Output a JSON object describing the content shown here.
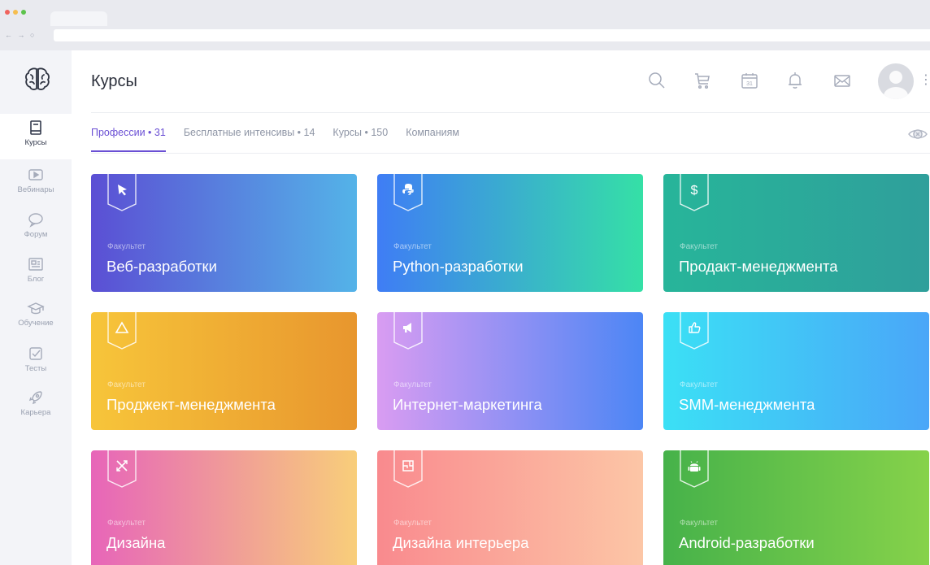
{
  "header": {
    "title": "Курсы"
  },
  "sidebar": {
    "items": [
      {
        "label": "Курсы",
        "icon": "book-icon"
      },
      {
        "label": "Вебинары",
        "icon": "play-icon"
      },
      {
        "label": "Форум",
        "icon": "chat-icon"
      },
      {
        "label": "Блог",
        "icon": "newspaper-icon"
      },
      {
        "label": "Обучение",
        "icon": "graduation-cap-icon"
      },
      {
        "label": "Тесты",
        "icon": "checkbox-icon"
      },
      {
        "label": "Карьера",
        "icon": "rocket-icon"
      }
    ]
  },
  "tabs": [
    {
      "label": "Профессии • 31",
      "active": true
    },
    {
      "label": "Бесплатные интенсивы • 14",
      "active": false
    },
    {
      "label": "Курсы • 150",
      "active": false
    },
    {
      "label": "Компаниям",
      "active": false
    }
  ],
  "cards": [
    {
      "kicker": "Факультет",
      "title": "Веб-разработки",
      "icon": "cursor-icon",
      "colors": [
        "#5b4fd4",
        "#54b3e8"
      ]
    },
    {
      "kicker": "Факультет",
      "title": "Python-разработки",
      "icon": "python-icon",
      "colors": [
        "#3f7df5",
        "#35e0a6"
      ]
    },
    {
      "kicker": "Факультет",
      "title": "Продакт-менеджмента",
      "icon": "dollar-icon",
      "colors": [
        "#27b59a",
        "#2f9f9b"
      ]
    },
    {
      "kicker": "Факультет",
      "title": "Проджект-менеджмента",
      "icon": "triangle-icon",
      "colors": [
        "#f7c53a",
        "#e8962e"
      ]
    },
    {
      "kicker": "Факультет",
      "title": "Интернет-маркетинга",
      "icon": "megaphone-icon",
      "colors": [
        "#d99cf2",
        "#4c86f5"
      ]
    },
    {
      "kicker": "Факультет",
      "title": "SMM-менеджмента",
      "icon": "thumbs-up-icon",
      "colors": [
        "#3be0f5",
        "#4aa6f8"
      ]
    },
    {
      "kicker": "Факультет",
      "title": "Дизайна",
      "icon": "design-tools-icon",
      "colors": [
        "#e765b9",
        "#f8ce7a"
      ]
    },
    {
      "kicker": "Факультет",
      "title": "Дизайна интерьера",
      "icon": "floor-plan-icon",
      "colors": [
        "#f98a8e",
        "#fcc6a6"
      ]
    },
    {
      "kicker": "Факультет",
      "title": "Android-разработки",
      "icon": "android-icon",
      "colors": [
        "#46b24a",
        "#86d24a"
      ]
    }
  ]
}
